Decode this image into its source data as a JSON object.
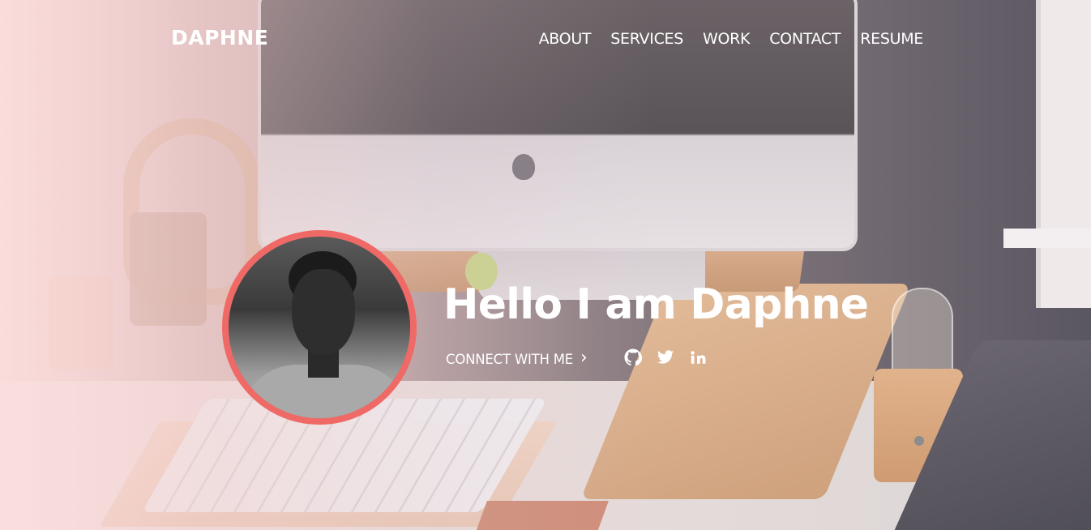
{
  "brand": {
    "name": "DAPHNE"
  },
  "nav": {
    "items": [
      {
        "label": "ABOUT"
      },
      {
        "label": "SERVICES"
      },
      {
        "label": "WORK"
      },
      {
        "label": "CONTACT"
      },
      {
        "label": "RESUME"
      }
    ]
  },
  "hero": {
    "headline": "Hello I am Daphne",
    "connect_label": "CONNECT WITH ME",
    "connect_arrow": "›",
    "social": [
      {
        "icon": "github-icon"
      },
      {
        "icon": "twitter-icon"
      },
      {
        "icon": "linkedin-icon"
      }
    ]
  },
  "colors": {
    "accent": "#ef6a66",
    "text": "#ffffff"
  }
}
